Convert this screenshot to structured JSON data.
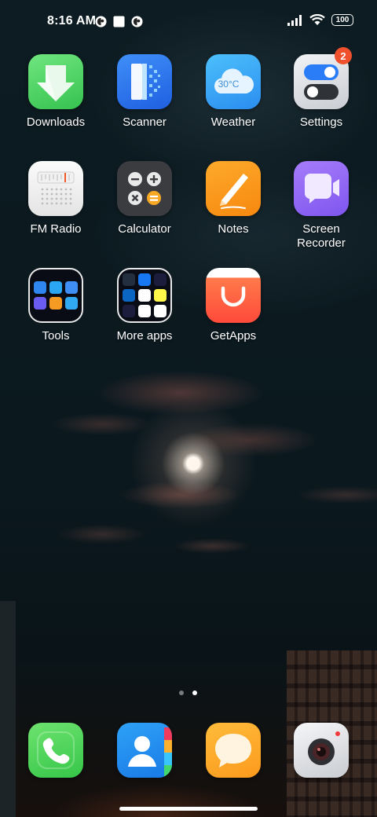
{
  "status_bar": {
    "time": "8:16 AM",
    "battery": "100",
    "icons": [
      "notification-app-icon",
      "notification-square-icon",
      "notification-app-icon",
      "signal-icon",
      "wifi-icon",
      "battery-icon"
    ]
  },
  "apps": [
    {
      "label": "Downloads"
    },
    {
      "label": "Scanner"
    },
    {
      "label": "Weather",
      "icon_text": "30°C"
    },
    {
      "label": "Settings",
      "badge": "2"
    },
    {
      "label": "FM Radio"
    },
    {
      "label": "Calculator"
    },
    {
      "label": "Notes"
    },
    {
      "label": "Screen\nRecorder"
    },
    {
      "label": "Tools"
    },
    {
      "label": "More apps"
    },
    {
      "label": "GetApps"
    }
  ],
  "page_indicator": {
    "pages": 2,
    "current": 2
  },
  "dock": [
    "phone",
    "contacts",
    "messaging",
    "camera"
  ],
  "colors": {
    "downloads": "#4cd664",
    "scanner": "#2f7bf5",
    "weather": "#38a5f6",
    "settings": "#e6e8ec",
    "notes": "#fa9a1e",
    "screen_recorder": "#9b6cf6",
    "getapps": "#ff5a3c",
    "badge": "#f0512c"
  }
}
